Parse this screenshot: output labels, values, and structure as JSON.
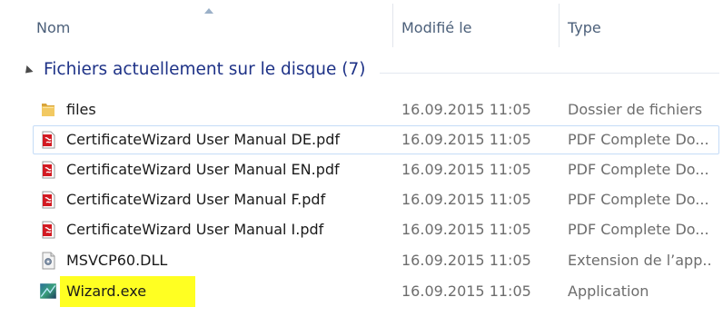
{
  "columns": {
    "name": "Nom",
    "modified": "Modifié le",
    "type": "Type"
  },
  "group": {
    "label": "Fichiers actuellement sur le disque (7)"
  },
  "files": [
    {
      "name": "files",
      "modified": "16.09.2015 11:05",
      "type": "Dossier de fichiers",
      "icon": "folder-icon"
    },
    {
      "name": "CertificateWizard User Manual DE.pdf",
      "modified": "16.09.2015 11:05",
      "type": "PDF Complete Do...",
      "icon": "pdf-icon"
    },
    {
      "name": "CertificateWizard User Manual EN.pdf",
      "modified": "16.09.2015 11:05",
      "type": "PDF Complete Do...",
      "icon": "pdf-icon"
    },
    {
      "name": "CertificateWizard User Manual F.pdf",
      "modified": "16.09.2015 11:05",
      "type": "PDF Complete Do...",
      "icon": "pdf-icon"
    },
    {
      "name": "CertificateWizard User Manual I.pdf",
      "modified": "16.09.2015 11:05",
      "type": "PDF Complete Do...",
      "icon": "pdf-icon"
    },
    {
      "name": "MSVCP60.DLL",
      "modified": "16.09.2015 11:05",
      "type": "Extension de l’app...",
      "icon": "dll-icon"
    },
    {
      "name": "Wizard.exe",
      "modified": "16.09.2015 11:05",
      "type": "Application",
      "icon": "exe-icon"
    }
  ],
  "colors": {
    "group_label": "#1e3287",
    "header_text": "#4c607a",
    "highlight": "#ffff22",
    "pdf_red": "#d21a22",
    "folder": "#e8b94a"
  }
}
